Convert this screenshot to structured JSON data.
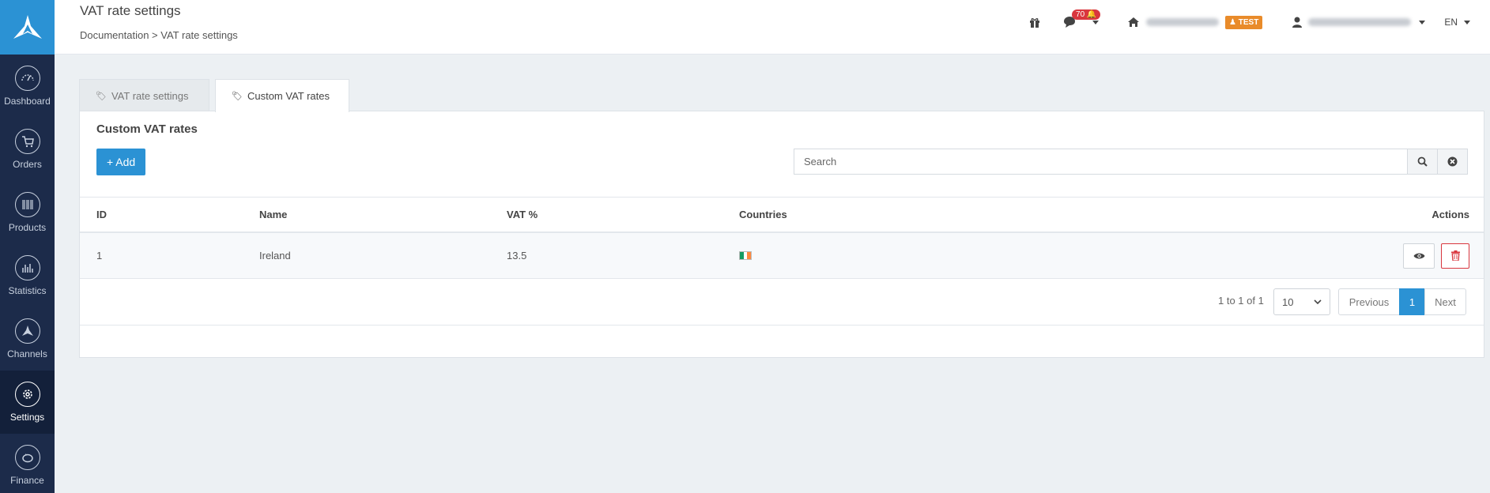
{
  "header": {
    "title": "VAT rate settings",
    "breadcrumb": "Documentation > VAT rate settings",
    "notification_count": "70",
    "test_badge": "TEST",
    "language": "EN"
  },
  "sidebar": {
    "items": [
      {
        "label": "Dashboard",
        "icon": "gauge-icon"
      },
      {
        "label": "Orders",
        "icon": "cart-icon"
      },
      {
        "label": "Products",
        "icon": "barcode-icon"
      },
      {
        "label": "Statistics",
        "icon": "chart-icon"
      },
      {
        "label": "Channels",
        "icon": "channels-icon"
      },
      {
        "label": "Settings",
        "icon": "gear-icon",
        "active": true
      },
      {
        "label": "Finance",
        "icon": "piggybank-icon"
      }
    ]
  },
  "tabs": [
    {
      "label": "VAT rate settings",
      "active": false
    },
    {
      "label": "Custom VAT rates",
      "active": true
    }
  ],
  "panel": {
    "title": "Custom VAT rates",
    "add_label": "+ Add",
    "search_placeholder": "Search"
  },
  "table": {
    "columns": [
      "ID",
      "Name",
      "VAT %",
      "Countries",
      "Actions"
    ],
    "rows": [
      {
        "id": "1",
        "name": "Ireland",
        "vat": "13.5",
        "countries": [
          "IE"
        ]
      }
    ]
  },
  "pagination": {
    "info": "1 to 1 of 1",
    "page_size": "10",
    "previous": "Previous",
    "current": "1",
    "next": "Next"
  },
  "colors": {
    "accent": "#2b92d4",
    "sidebar": "#1c2b4a",
    "danger": "#d9363e",
    "warning": "#e98b2a"
  }
}
